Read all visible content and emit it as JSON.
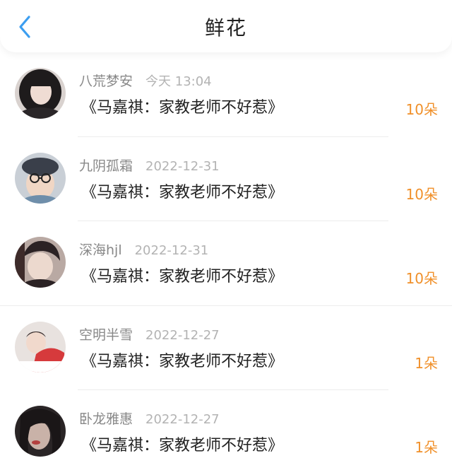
{
  "header": {
    "title": "鲜花"
  },
  "colors": {
    "accent_blue": "#3c9ef0",
    "count_orange": "#f0902a"
  },
  "icons": {
    "back": "chevron-left-icon"
  },
  "items": [
    {
      "name": "八荒梦安",
      "date": "今天 13:04",
      "book": "《马嘉祺：家教老师不好惹》",
      "count": "10朵"
    },
    {
      "name": "九阴孤霜",
      "date": "2022-12-31",
      "book": "《马嘉祺：家教老师不好惹》",
      "count": "10朵"
    },
    {
      "name": "深海hjl",
      "date": "2022-12-31",
      "book": "《马嘉祺：家教老师不好惹》",
      "count": "10朵"
    },
    {
      "name": "空明半雪",
      "date": "2022-12-27",
      "book": "《马嘉祺：家教老师不好惹》",
      "count": "1朵"
    },
    {
      "name": "卧龙雅惠",
      "date": "2022-12-27",
      "book": "《马嘉祺：家教老师不好惹》",
      "count": "1朵"
    }
  ]
}
